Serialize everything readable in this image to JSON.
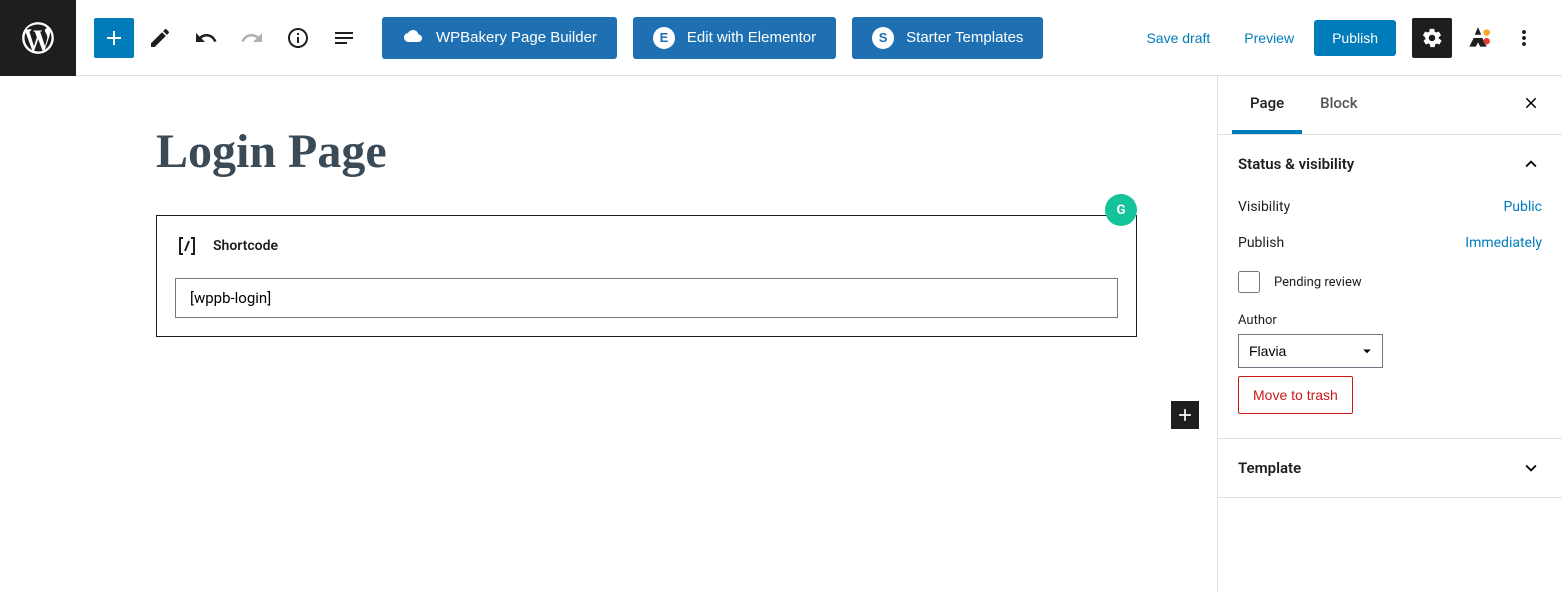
{
  "toolbar": {
    "wpbakery": "WPBakery Page Builder",
    "elementor": "Edit with Elementor",
    "starter": "Starter Templates",
    "save_draft": "Save draft",
    "preview": "Preview",
    "publish": "Publish"
  },
  "editor": {
    "title": "Login Page",
    "shortcode_label": "Shortcode",
    "shortcode_value": "[wppb-login]"
  },
  "sidebar": {
    "tabs": {
      "page": "Page",
      "block": "Block"
    },
    "status": {
      "header": "Status & visibility",
      "visibility_label": "Visibility",
      "visibility_value": "Public",
      "publish_label": "Publish",
      "publish_value": "Immediately",
      "pending": "Pending review",
      "author_label": "Author",
      "author_value": "Flavia",
      "trash": "Move to trash"
    },
    "template": {
      "header": "Template"
    }
  }
}
